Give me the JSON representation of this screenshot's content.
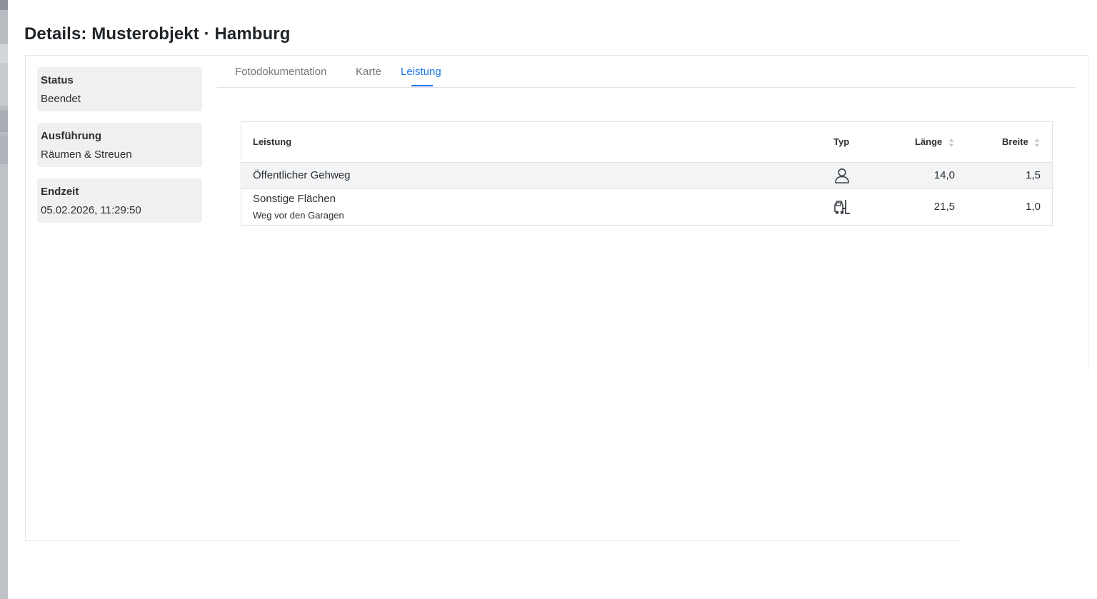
{
  "dialog": {
    "title": "Details: Musterobjekt · Hamburg"
  },
  "info_cards": [
    {
      "label": "Status",
      "value": "Beendet"
    },
    {
      "label": "Ausführung",
      "value": "Räumen & Streuen"
    },
    {
      "label": "Endzeit",
      "value": "05.02.2026, 11:29:50"
    }
  ],
  "tabs": [
    {
      "label": "Fotodokumentation",
      "active": false
    },
    {
      "label": "Karte",
      "active": false
    },
    {
      "label": "Leistung",
      "active": true
    }
  ],
  "table": {
    "headers": {
      "leistung": "Leistung",
      "typ": "Typ",
      "laenge": "Länge",
      "breite": "Breite"
    },
    "rows": [
      {
        "name": "Öffentlicher Gehweg",
        "subtitle": "",
        "type_icon": "person-icon",
        "laenge": "14,0",
        "breite": "1,5"
      },
      {
        "name": "Sonstige Flächen",
        "subtitle": "Weg vor den Garagen",
        "type_icon": "forklift-icon",
        "laenge": "21,5",
        "breite": "1,0"
      }
    ]
  },
  "colors": {
    "accent": "#1a73e8",
    "card_bg": "#f0f0f0",
    "row_highlight": "#f3f4f5"
  }
}
